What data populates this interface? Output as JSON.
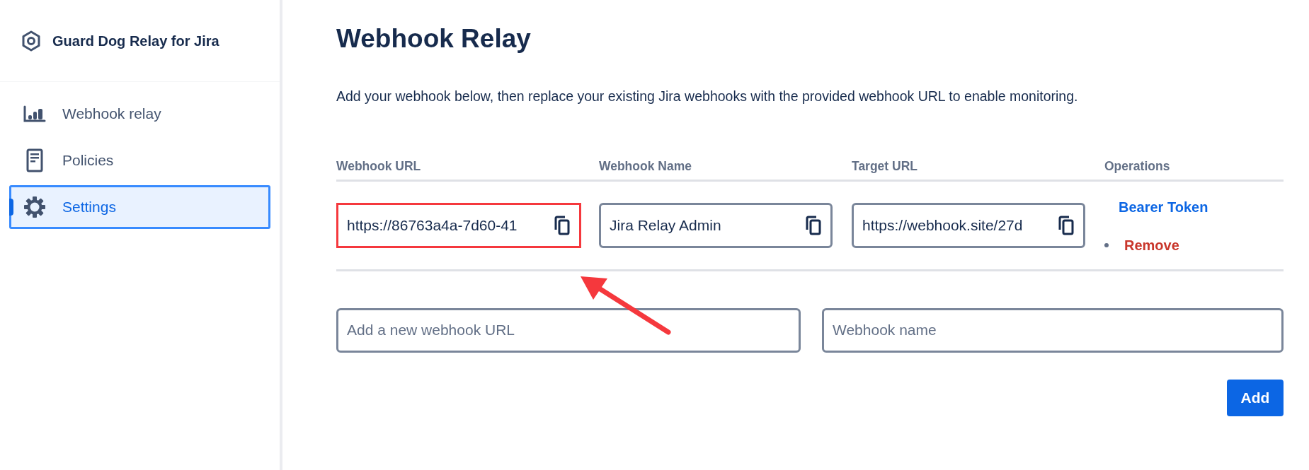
{
  "sidebar": {
    "app_title": "Guard Dog Relay for Jira",
    "items": [
      {
        "label": "Webhook relay",
        "selected": false
      },
      {
        "label": "Policies",
        "selected": false
      },
      {
        "label": "Settings",
        "selected": true
      }
    ]
  },
  "page": {
    "title": "Webhook Relay",
    "description": "Add your webhook below, then replace your existing Jira webhooks with the provided webhook URL to enable monitoring."
  },
  "table": {
    "columns": [
      "Webhook URL",
      "Webhook Name",
      "Target URL",
      "Operations"
    ],
    "rows": [
      {
        "fields": [
          {
            "value": "https://86763a4a-7d60-41",
            "highlighted": true
          },
          {
            "value": "Jira Relay Admin",
            "highlighted": false
          },
          {
            "value": "https://webhook.site/27d",
            "highlighted": false
          }
        ],
        "operations": [
          {
            "label": "Bearer Token",
            "kind": "link"
          },
          {
            "label": "Remove",
            "kind": "danger"
          }
        ]
      }
    ]
  },
  "new_webhook": {
    "url_placeholder": "Add a new webhook URL",
    "name_placeholder": "Webhook name",
    "button": "Add"
  }
}
